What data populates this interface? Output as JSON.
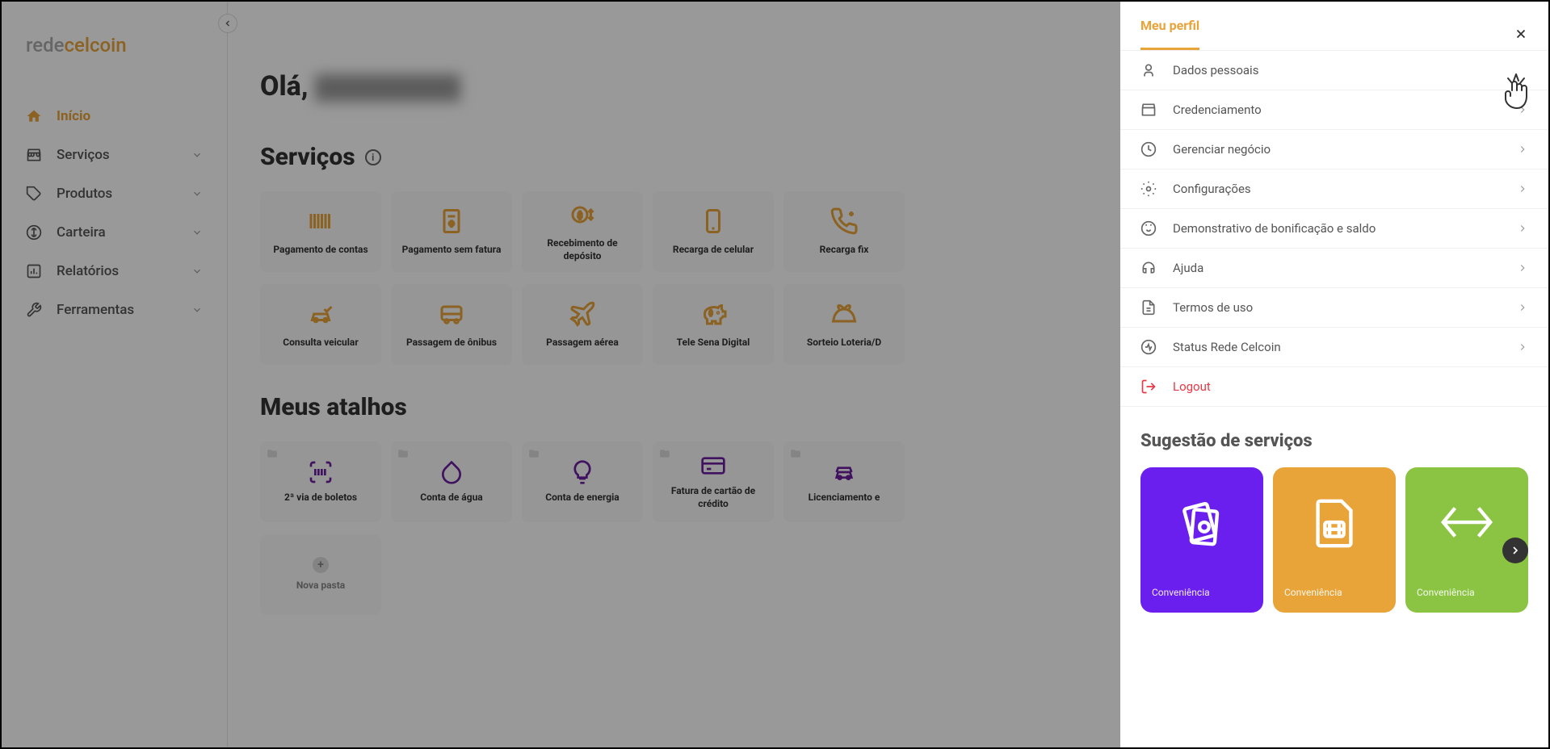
{
  "logo": {
    "part1": "rede",
    "part2": "cel",
    "part3": "coin"
  },
  "sidebar": {
    "items": [
      {
        "label": "Início",
        "active": true
      },
      {
        "label": "Serviços"
      },
      {
        "label": "Produtos"
      },
      {
        "label": "Carteira"
      },
      {
        "label": "Relatórios"
      },
      {
        "label": "Ferramentas"
      }
    ]
  },
  "greeting": {
    "text": "Olá,"
  },
  "sections": {
    "services_title": "Serviços",
    "shortcuts_title": "Meus atalhos"
  },
  "services": [
    {
      "label": "Pagamento de contas"
    },
    {
      "label": "Pagamento sem fatura"
    },
    {
      "label": "Recebimento de depósito"
    },
    {
      "label": "Recarga de celular"
    },
    {
      "label": "Recarga fix"
    },
    {
      "label": "Consulta veicular"
    },
    {
      "label": "Passagem de ônibus"
    },
    {
      "label": "Passagem aérea"
    },
    {
      "label": "Tele Sena Digital"
    },
    {
      "label": "Sorteio Loteria/D"
    }
  ],
  "shortcuts": [
    {
      "label": "2ª via de boletos"
    },
    {
      "label": "Conta de água"
    },
    {
      "label": "Conta de energia"
    },
    {
      "label": "Fatura de cartão de crédito"
    },
    {
      "label": "Licenciamento e"
    },
    {
      "label": "Nova pasta",
      "add": true
    }
  ],
  "panel": {
    "title": "Meu perfil",
    "menu": [
      {
        "label": "Dados pessoais"
      },
      {
        "label": "Credenciamento"
      },
      {
        "label": "Gerenciar negócio"
      },
      {
        "label": "Configurações"
      },
      {
        "label": "Demonstrativo de bonificação e saldo"
      },
      {
        "label": "Ajuda"
      },
      {
        "label": "Termos de uso"
      },
      {
        "label": "Status Rede Celcoin"
      },
      {
        "label": "Logout",
        "logout": true
      }
    ],
    "suggestion_title": "Sugestão de serviços",
    "suggestions": [
      {
        "category": "Conveniência",
        "color": "purple"
      },
      {
        "category": "Conveniência",
        "color": "orange"
      },
      {
        "category": "Conveniência",
        "color": "green"
      }
    ]
  }
}
